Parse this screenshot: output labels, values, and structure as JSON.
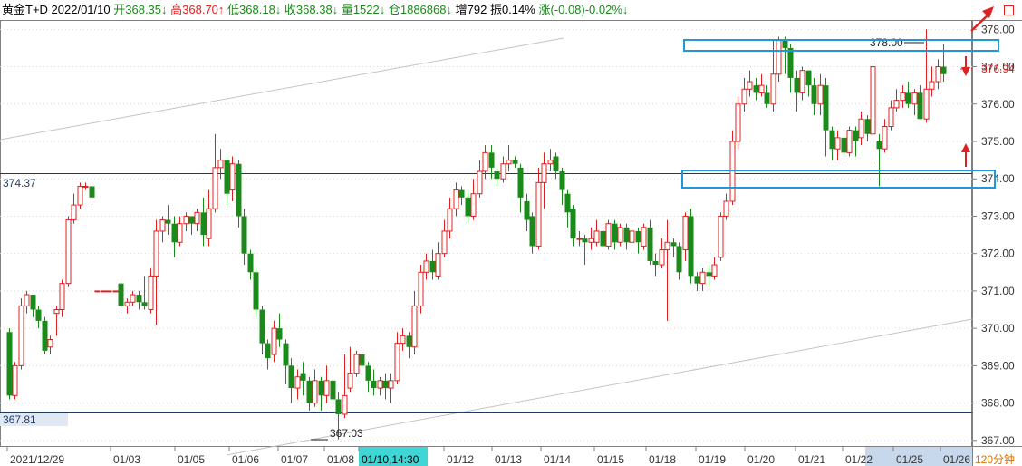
{
  "header": {
    "instrument": "黄金T+D",
    "date": "2022/01/10",
    "open": "开368.35↓",
    "high": "高368.70↑",
    "low": "低368.18↓",
    "close": "收368.38↓",
    "volume": "量1522↓",
    "open_interest": "仓1886868↓",
    "increase": "增792",
    "amplitude": "振0.14%",
    "change": "涨(-0.08)-0.02%↓"
  },
  "colors": {
    "up": "#e02020",
    "down": "#1a8a1a",
    "axis": "#808080",
    "annot": "#2196d8",
    "hline": "#1f3a5f"
  },
  "chart_data": {
    "type": "candlestick",
    "period": "120分钟",
    "ylim": [
      366.85,
      378.25
    ],
    "y_ticks": [
      "378.00",
      "377.00",
      "376.00",
      "375.00",
      "374.00",
      "373.00",
      "372.00",
      "371.00",
      "370.00",
      "369.00",
      "368.00",
      "367.00"
    ],
    "current_price": "376.94",
    "levels": {
      "upper": "374.37",
      "lower": "367.81"
    },
    "annotations": {
      "high_label": "378.00",
      "low_label": "367.03"
    },
    "x_labels": [
      "2021/12/29",
      "01/03",
      "01/05",
      "01/06",
      "01/07",
      "01/08",
      "01/10,14:30",
      "01/12",
      "01/13",
      "01/14",
      "01/15",
      "01/18",
      "01/19",
      "01/20",
      "01/21",
      "01/22",
      "01/25",
      "01/26"
    ],
    "candles": [
      [
        369.9,
        368.2,
        370.0,
        368.1
      ],
      [
        368.2,
        369.0,
        369.1,
        368.1
      ],
      [
        369.0,
        370.6,
        370.8,
        368.9
      ],
      [
        370.6,
        370.9,
        371.0,
        370.4
      ],
      [
        370.9,
        370.5,
        370.9,
        370.3
      ],
      [
        370.5,
        370.2,
        370.6,
        370.0
      ],
      [
        370.2,
        369.4,
        370.3,
        369.3
      ],
      [
        369.5,
        369.7,
        369.8,
        369.3
      ],
      [
        370.4,
        370.5,
        370.6,
        369.8
      ],
      [
        370.5,
        371.2,
        371.3,
        370.3
      ],
      [
        371.2,
        372.9,
        373.0,
        371.1
      ],
      [
        372.9,
        373.3,
        373.6,
        372.8
      ],
      [
        373.3,
        373.8,
        373.9,
        373.2
      ],
      [
        373.8,
        373.8,
        373.9,
        373.7
      ],
      [
        373.8,
        373.5,
        373.9,
        373.3
      ],
      [
        371.0,
        371.0,
        371.0,
        371.0
      ],
      [
        371.0,
        371.0,
        371.0,
        371.0
      ],
      [
        371.0,
        371.0,
        371.0,
        371.0
      ],
      [
        371.0,
        371.0,
        371.0,
        371.0
      ],
      [
        371.2,
        370.6,
        371.4,
        370.4
      ],
      [
        370.6,
        370.7,
        370.8,
        370.4
      ],
      [
        370.7,
        370.9,
        371.0,
        370.6
      ],
      [
        370.9,
        370.7,
        371.0,
        370.5
      ],
      [
        370.7,
        370.6,
        371.4,
        370.5
      ],
      [
        370.5,
        371.4,
        371.6,
        370.4
      ],
      [
        371.4,
        372.6,
        372.9,
        370.1
      ],
      [
        372.6,
        372.9,
        373.0,
        372.3
      ],
      [
        372.9,
        372.8,
        373.3,
        372.5
      ],
      [
        372.8,
        372.3,
        373.0,
        371.9
      ],
      [
        372.3,
        372.8,
        373.0,
        372.2
      ],
      [
        372.8,
        373.0,
        373.1,
        372.6
      ],
      [
        373.0,
        372.8,
        373.0,
        372.5
      ],
      [
        372.8,
        373.1,
        373.2,
        372.6
      ],
      [
        373.1,
        372.5,
        373.5,
        372.2
      ],
      [
        372.4,
        373.2,
        373.7,
        372.2
      ],
      [
        373.2,
        374.3,
        375.2,
        373.1
      ],
      [
        374.3,
        374.5,
        374.8,
        374.0
      ],
      [
        374.5,
        373.6,
        374.6,
        373.3
      ],
      [
        373.7,
        374.4,
        374.6,
        373.4
      ],
      [
        374.4,
        373.0,
        374.5,
        372.7
      ],
      [
        373.0,
        372.0,
        373.2,
        371.7
      ],
      [
        372.0,
        371.5,
        372.1,
        371.3
      ],
      [
        371.5,
        370.5,
        371.6,
        370.3
      ],
      [
        370.5,
        369.6,
        370.6,
        369.3
      ],
      [
        369.6,
        369.2,
        369.7,
        368.9
      ],
      [
        369.3,
        370.0,
        370.2,
        369.1
      ],
      [
        370.0,
        369.7,
        370.4,
        369.5
      ],
      [
        369.6,
        369.0,
        369.7,
        368.5
      ],
      [
        369.0,
        368.4,
        369.2,
        368.0
      ],
      [
        368.4,
        368.7,
        368.9,
        368.1
      ],
      [
        368.8,
        368.6,
        369.1,
        368.2
      ],
      [
        368.6,
        368.0,
        368.7,
        367.8
      ],
      [
        368.0,
        368.6,
        368.9,
        367.9
      ],
      [
        368.6,
        368.2,
        368.7,
        367.8
      ],
      [
        368.2,
        368.6,
        369.0,
        368.0
      ],
      [
        368.6,
        368.1,
        368.7,
        367.9
      ],
      [
        368.1,
        367.7,
        368.3,
        367.03
      ],
      [
        367.7,
        368.2,
        369.3,
        367.6
      ],
      [
        368.4,
        368.8,
        369.5,
        368.3
      ],
      [
        368.8,
        369.3,
        369.4,
        368.7
      ],
      [
        369.3,
        369.0,
        369.5,
        368.6
      ],
      [
        369.0,
        368.6,
        369.1,
        368.3
      ],
      [
        368.6,
        368.4,
        368.9,
        368.2
      ],
      [
        368.4,
        368.6,
        368.7,
        368.2
      ],
      [
        368.6,
        368.4,
        368.8,
        368.1
      ],
      [
        368.4,
        368.6,
        368.8,
        368.0
      ],
      [
        368.6,
        369.6,
        369.9,
        368.5
      ],
      [
        369.6,
        369.8,
        370.0,
        369.4
      ],
      [
        369.8,
        369.5,
        369.9,
        369.2
      ],
      [
        369.5,
        370.6,
        371.0,
        369.3
      ],
      [
        370.6,
        371.5,
        371.7,
        370.4
      ],
      [
        371.5,
        371.8,
        372.0,
        371.3
      ],
      [
        371.8,
        371.5,
        372.1,
        371.3
      ],
      [
        371.4,
        372.0,
        372.3,
        371.3
      ],
      [
        372.0,
        372.6,
        372.9,
        371.9
      ],
      [
        372.6,
        373.2,
        373.5,
        372.4
      ],
      [
        373.2,
        373.7,
        373.9,
        373.0
      ],
      [
        373.7,
        373.5,
        373.8,
        373.3
      ],
      [
        373.5,
        373.0,
        373.7,
        372.8
      ],
      [
        373.0,
        373.6,
        374.0,
        372.9
      ],
      [
        373.6,
        374.2,
        374.5,
        373.5
      ],
      [
        374.2,
        374.7,
        374.9,
        374.0
      ],
      [
        374.7,
        374.3,
        374.9,
        374.0
      ],
      [
        374.2,
        374.0,
        374.3,
        373.8
      ],
      [
        374.0,
        374.4,
        374.6,
        373.9
      ],
      [
        374.4,
        374.5,
        374.9,
        374.2
      ],
      [
        374.5,
        374.4,
        374.6,
        374.3
      ],
      [
        374.3,
        373.5,
        374.4,
        373.1
      ],
      [
        373.4,
        372.9,
        373.6,
        372.6
      ],
      [
        373.0,
        372.2,
        373.1,
        372.0
      ],
      [
        372.2,
        373.9,
        374.3,
        372.1
      ],
      [
        373.9,
        374.4,
        374.7,
        373.2
      ],
      [
        374.4,
        374.5,
        374.8,
        374.2
      ],
      [
        374.6,
        374.2,
        374.7,
        374.0
      ],
      [
        374.2,
        373.7,
        374.3,
        373.3
      ],
      [
        373.6,
        373.1,
        373.7,
        372.7
      ],
      [
        373.2,
        372.4,
        373.3,
        372.2
      ],
      [
        372.4,
        372.4,
        372.6,
        372.2
      ],
      [
        372.4,
        372.3,
        372.5,
        371.7
      ],
      [
        372.3,
        372.4,
        372.7,
        372.1
      ],
      [
        372.3,
        372.6,
        372.9,
        372.2
      ],
      [
        372.6,
        372.2,
        372.8,
        372.0
      ],
      [
        372.2,
        372.8,
        372.9,
        372.1
      ],
      [
        372.8,
        372.3,
        372.9,
        372.1
      ],
      [
        372.3,
        372.7,
        372.8,
        372.2
      ],
      [
        372.7,
        372.3,
        372.8,
        372.1
      ],
      [
        372.3,
        372.6,
        372.8,
        372.2
      ],
      [
        372.6,
        372.3,
        372.7,
        372.0
      ],
      [
        372.2,
        372.7,
        372.8,
        372.1
      ],
      [
        372.7,
        371.8,
        372.9,
        371.7
      ],
      [
        371.8,
        371.7,
        372.0,
        371.4
      ],
      [
        371.7,
        372.1,
        372.4,
        371.6
      ],
      [
        372.1,
        372.3,
        372.9,
        370.2
      ],
      [
        372.3,
        372.2,
        372.4,
        371.9
      ],
      [
        372.2,
        371.5,
        372.3,
        371.3
      ],
      [
        372.1,
        373.0,
        373.1,
        371.8
      ],
      [
        373.0,
        371.4,
        373.2,
        371.2
      ],
      [
        371.4,
        371.2,
        371.5,
        371.0
      ],
      [
        371.2,
        371.5,
        371.6,
        371.0
      ],
      [
        371.5,
        371.4,
        371.7,
        371.1
      ],
      [
        371.4,
        371.7,
        371.9,
        371.3
      ],
      [
        371.9,
        373.0,
        373.1,
        371.8
      ],
      [
        373.0,
        373.4,
        373.6,
        372.9
      ],
      [
        373.4,
        375.0,
        375.3,
        373.3
      ],
      [
        375.0,
        376.0,
        376.2,
        374.8
      ],
      [
        376.0,
        376.4,
        376.7,
        375.8
      ],
      [
        376.4,
        376.6,
        376.9,
        376.2
      ],
      [
        376.5,
        376.3,
        376.7,
        376.1
      ],
      [
        376.3,
        376.5,
        376.8,
        376.2
      ],
      [
        376.3,
        376.0,
        376.5,
        375.9
      ],
      [
        376.0,
        376.8,
        377.7,
        375.8
      ],
      [
        376.8,
        377.7,
        377.8,
        376.6
      ],
      [
        377.7,
        377.5,
        377.8,
        376.8
      ],
      [
        377.5,
        376.7,
        377.6,
        376.3
      ],
      [
        376.7,
        376.3,
        376.9,
        375.8
      ],
      [
        376.3,
        376.9,
        377.0,
        376.1
      ],
      [
        376.9,
        376.5,
        376.9,
        376.2
      ],
      [
        376.5,
        376.0,
        376.7,
        375.7
      ],
      [
        376.0,
        376.5,
        376.8,
        375.7
      ],
      [
        376.5,
        375.3,
        376.7,
        374.6
      ],
      [
        375.3,
        374.8,
        375.4,
        374.5
      ],
      [
        374.8,
        375.1,
        375.3,
        374.5
      ],
      [
        375.1,
        374.7,
        375.3,
        374.5
      ],
      [
        374.7,
        375.3,
        375.4,
        374.6
      ],
      [
        375.3,
        375.0,
        375.4,
        374.6
      ],
      [
        375.1,
        375.6,
        375.8,
        374.9
      ],
      [
        375.6,
        375.2,
        375.7,
        375.0
      ],
      [
        375.2,
        377.0,
        377.1,
        374.4
      ],
      [
        375.0,
        374.8,
        375.2,
        373.8
      ],
      [
        374.8,
        375.4,
        375.6,
        374.7
      ],
      [
        375.4,
        375.9,
        376.1,
        375.3
      ],
      [
        375.9,
        376.1,
        376.4,
        375.8
      ],
      [
        376.1,
        376.3,
        376.5,
        375.9
      ],
      [
        376.3,
        376.0,
        376.6,
        375.9
      ],
      [
        376.0,
        376.3,
        376.4,
        375.7
      ],
      [
        376.3,
        375.6,
        376.5,
        375.6
      ],
      [
        375.6,
        376.4,
        378.0,
        375.5
      ],
      [
        376.4,
        376.6,
        377.0,
        376.2
      ],
      [
        376.6,
        377.0,
        377.2,
        376.4
      ],
      [
        377.0,
        376.8,
        377.6,
        376.6
      ]
    ]
  }
}
